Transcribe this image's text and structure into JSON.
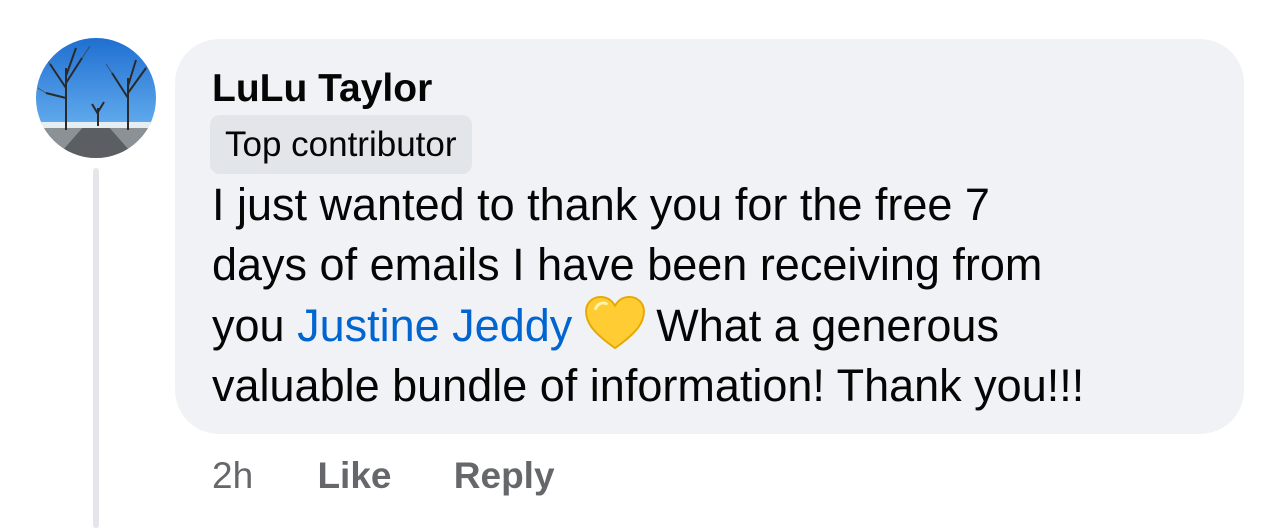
{
  "comment": {
    "author": "LuLu Taylor",
    "badge": "Top contributor",
    "text_lines": [
      "I just wanted to thank you for the free 7",
      "days of emails I have been receiving from",
      "you",
      "Justine Jeddy",
      "What a generous",
      "valuable bundle of information! Thank you!!!"
    ],
    "mention": "Justine Jeddy",
    "emoji": "yellow-heart-icon",
    "time": "2h",
    "like_label": "Like",
    "reply_label": "Reply"
  },
  "colors": {
    "bubble": "#f0f2f5",
    "badge": "#e2e5e9",
    "mention": "#0064d1",
    "meta": "#65676b",
    "heart": "#ffcc33"
  }
}
